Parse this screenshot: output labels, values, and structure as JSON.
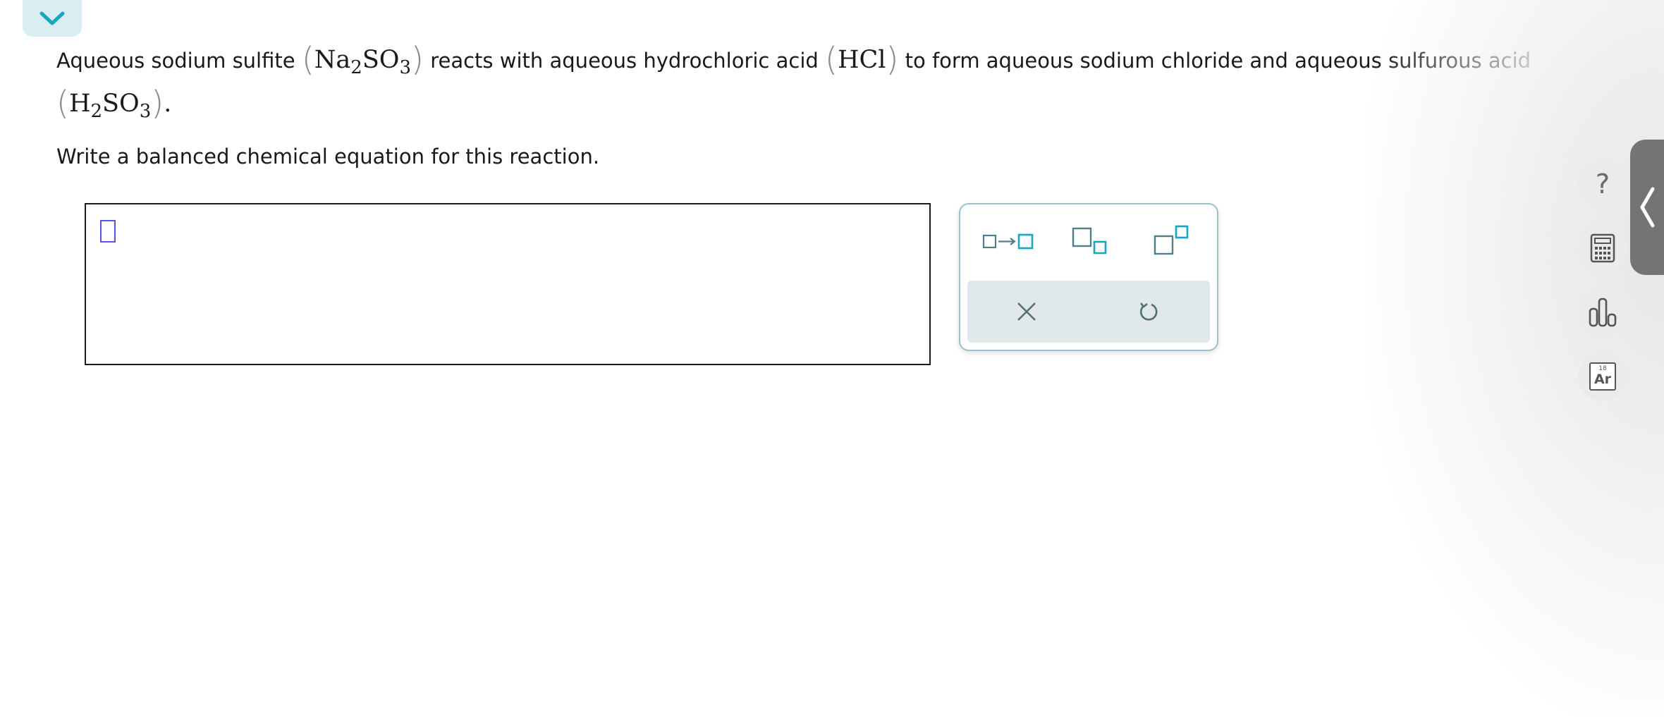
{
  "question": {
    "line1": {
      "t1": "Aqueous sodium sulfite ",
      "f1_a": "Na",
      "f1_b": "2",
      "f1_c": "SO",
      "f1_d": "3",
      "t2": " reacts with aqueous hydrochloric acid ",
      "f2": "HCl",
      "t3": " to form aqueous sodium chloride and aqueous sulfurous acid"
    },
    "line2": {
      "f3_a": "H",
      "f3_b": "2",
      "f3_c": "SO",
      "f3_d": "3",
      "period": "."
    },
    "instruction": "Write a balanced chemical equation for this reaction."
  },
  "answer": {
    "value": ""
  },
  "toolbar": {
    "buttons": [
      "reaction-arrow",
      "subscript",
      "superscript"
    ],
    "actions": [
      "clear",
      "undo"
    ]
  },
  "sidebar": {
    "help_label": "?",
    "periodic_number": "18",
    "periodic_symbol": "Ar"
  },
  "colors": {
    "accent": "#1ba6bf",
    "tool_icon": "#4f7f88",
    "cursor": "#5555e6"
  }
}
